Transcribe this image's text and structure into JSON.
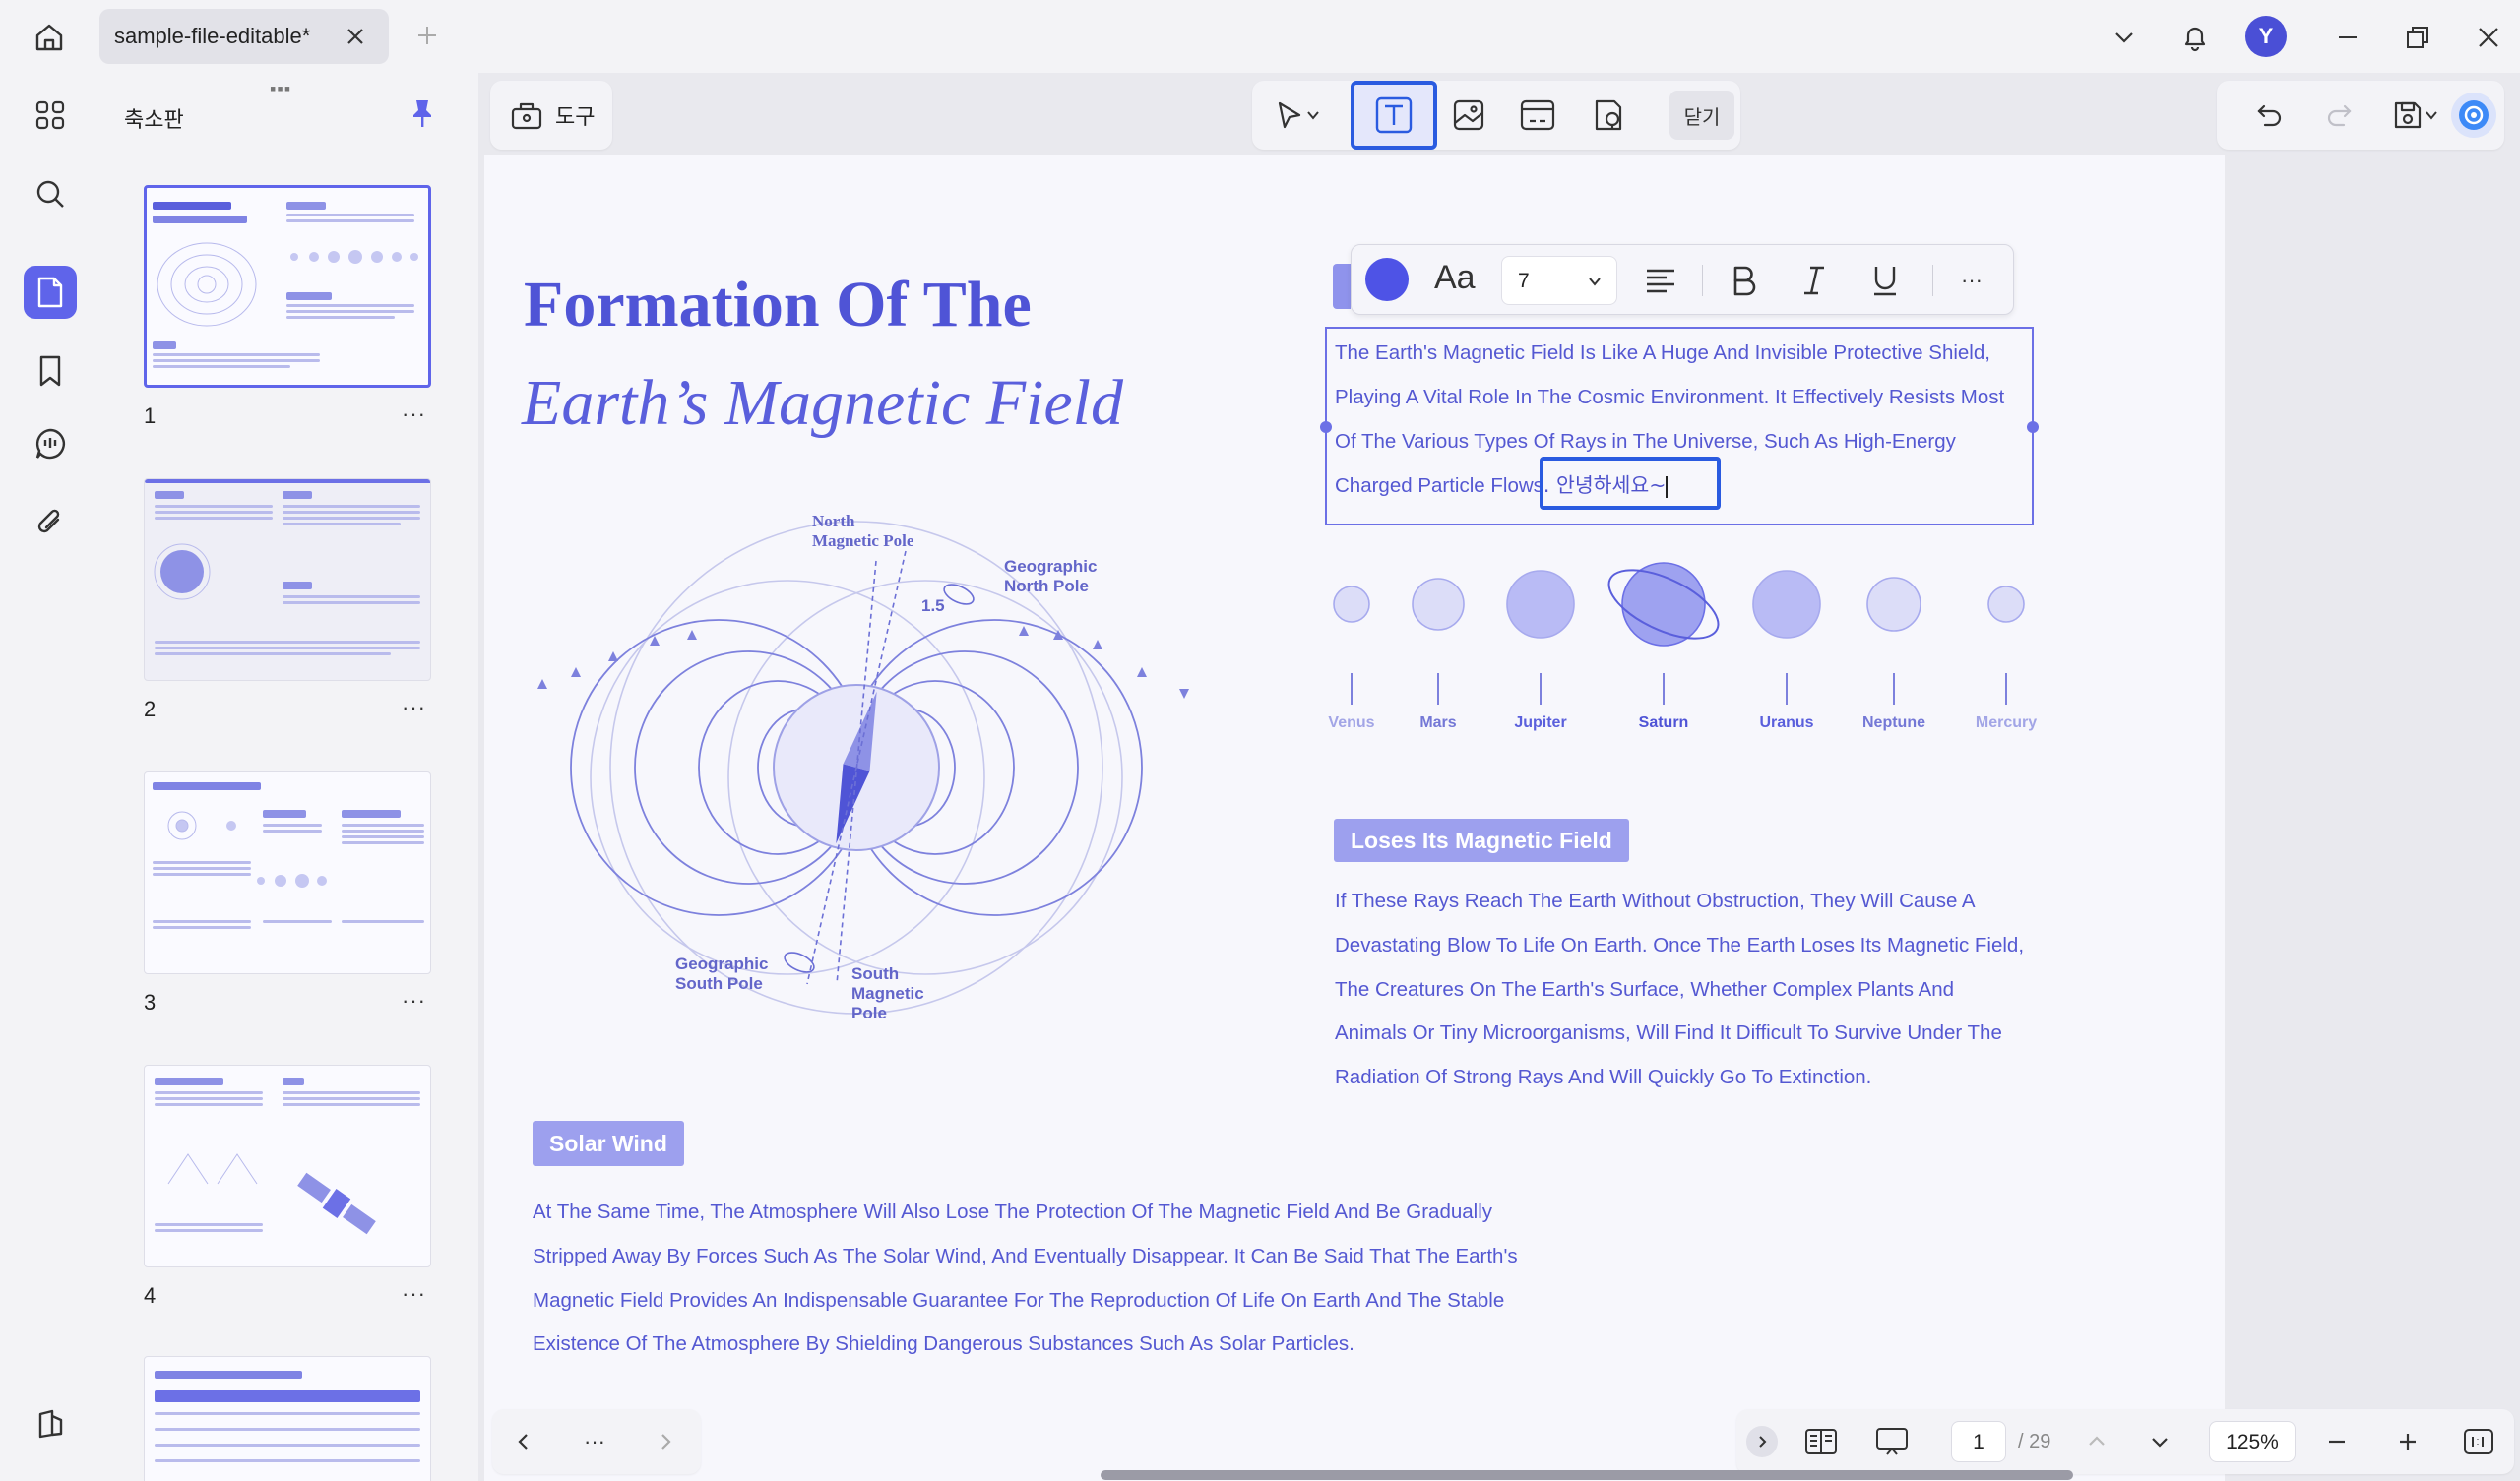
{
  "tabs": [
    {
      "label": "sample-file-editable*"
    }
  ],
  "titlebar": {
    "avatar_letter": "Y"
  },
  "thumbnails_panel": {
    "title": "축소판",
    "pages": [
      {
        "number": "1"
      },
      {
        "number": "2"
      },
      {
        "number": "3"
      },
      {
        "number": "4"
      }
    ]
  },
  "toolbar": {
    "tools_label": "도구",
    "close_label": "닫기"
  },
  "format_bar": {
    "font_size": "7",
    "color": "#4e53e6"
  },
  "page": {
    "title_line1": "Formation Of The",
    "title_line2": "Earth’s Magnetic Field",
    "edit_text": "The Earth's Magnetic Field Is Like A Huge And Invisible Protective Shield, Playing A Vital Role In The Cosmic Environment. It Effectively Resists Most Of The Various Types Of Rays in The Universe, Such As High-Energy Charged Particle Flows",
    "edit_insert": ". 안녕하세요~",
    "diagram": {
      "north_magnetic_pole": "North\nMagnetic Pole",
      "geographic_north_pole": "Geographic\nNorth Pole",
      "angle": "1.5",
      "geographic_south_pole": "Geographic\nSouth Pole",
      "south_magnetic_pole": "South\nMagnetic\nPole"
    },
    "planets": [
      "Venus",
      "Mars",
      "Jupiter",
      "Saturn",
      "Uranus",
      "Neptune",
      "Mercury"
    ],
    "section1_heading": "Loses Its Magnetic Field",
    "section1_text": "If These Rays Reach The Earth Without Obstruction, They Will Cause A Devastating Blow To Life On Earth. Once The Earth Loses Its Magnetic Field, The Creatures On The Earth's Surface, Whether Complex Plants And Animals Or Tiny Microorganisms, Will Find It Difficult To Survive Under The Radiation Of Strong Rays And Will Quickly Go To Extinction.",
    "section2_heading": "Solar Wind",
    "section2_text": "At The Same Time, The Atmosphere Will Also Lose The Protection Of The Magnetic Field And Be Gradually Stripped Away By Forces Such As The Solar Wind, And Eventually Disappear. It Can Be Said That The Earth's Magnetic Field Provides An Indispensable Guarantee For The Reproduction Of Life On Earth And The Stable Existence Of The Atmosphere By Shielding Dangerous Substances Such As Solar Particles."
  },
  "bottom_nav": {
    "more": "···",
    "current_page": "1",
    "total_pages": "/ 29",
    "zoom": "125%"
  },
  "colors": {
    "accent": "#5f64ea",
    "text": "#5458d2",
    "selection": "#2a5be0"
  }
}
